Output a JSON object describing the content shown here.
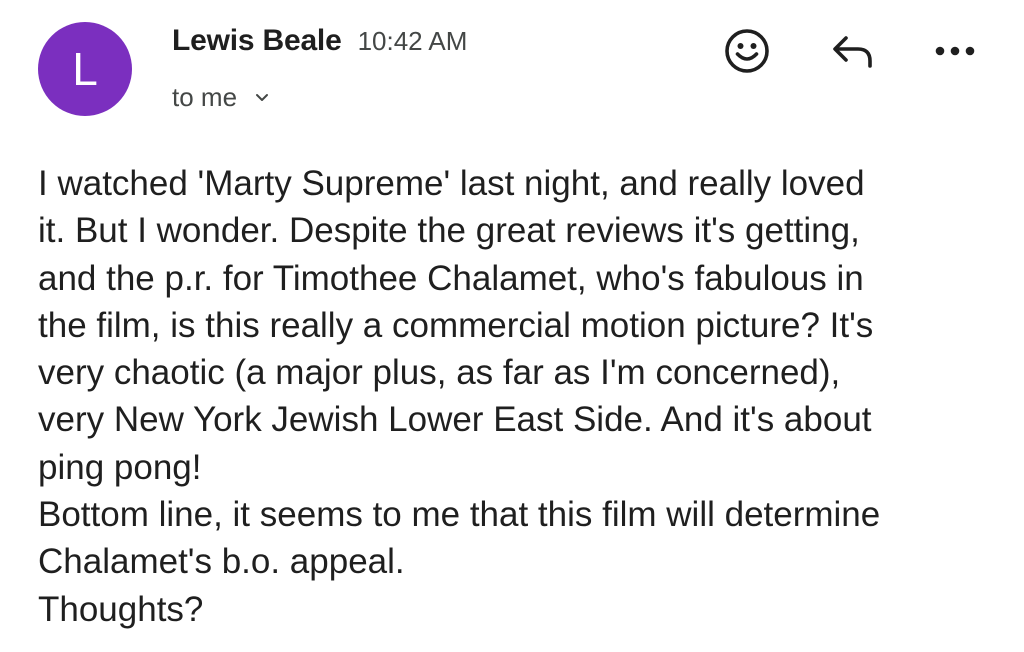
{
  "sender": {
    "avatar_letter": "L",
    "avatar_color": "#7b2fbf",
    "name": "Lewis Beale",
    "time": "10:42 AM"
  },
  "recipient": {
    "label": "to me"
  },
  "actions": [
    {
      "icon": "emoji-icon"
    },
    {
      "icon": "reply-icon"
    },
    {
      "icon": "more-options-icon"
    }
  ],
  "body": {
    "lines": [
      "I watched 'Marty Supreme' last night, and really loved",
      "it. But I wonder. Despite the great reviews it's getting,",
      "and the p.r. for Timothee Chalamet, who's fabulous in",
      "the film, is this really a commercial motion picture? It's",
      "very chaotic (a major plus, as far as I'm concerned),",
      "very New York Jewish Lower East Side. And it's about",
      "ping pong!",
      "Bottom line, it seems to me that this film will determine",
      "Chalamet's b.o. appeal.",
      "Thoughts?"
    ]
  }
}
